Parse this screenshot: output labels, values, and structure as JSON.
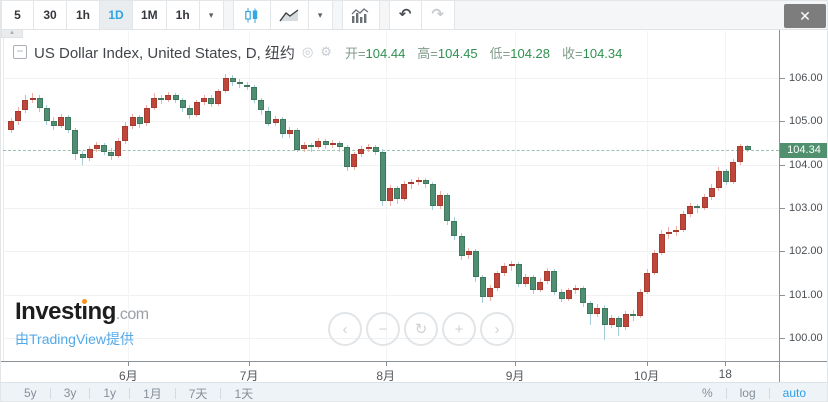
{
  "toolbar": {
    "intervals": [
      "5",
      "30",
      "1h",
      "1D",
      "1M",
      "1h"
    ],
    "selected_interval": "1D",
    "caret_icon": "▾",
    "undo_icon": "↶",
    "redo_icon": "↷",
    "close_icon": "✕",
    "collapse_tab_icon": "▴"
  },
  "header": {
    "collapse_icon": "−",
    "title": "US Dollar Index, United States, D, 纽约",
    "visibility_icon": "◎",
    "settings_icon": "⚙",
    "ohlc_readout": [
      {
        "label": "开",
        "value": "104.44"
      },
      {
        "label": "高",
        "value": "104.45"
      },
      {
        "label": "低",
        "value": "104.28"
      },
      {
        "label": "收",
        "value": "104.34"
      }
    ]
  },
  "chart_data": {
    "type": "candlestick",
    "symbol": "US Dollar Index",
    "region": "United States",
    "interval": "D",
    "exchange_label": "纽约",
    "ohlc": {
      "open": 104.44,
      "high": 104.45,
      "low": 104.28,
      "close": 104.34
    },
    "last_price": 104.34,
    "last_price_label": "104.34",
    "up_means": "close>open shown red (CN convention)",
    "y_axis": {
      "ticks": [
        {
          "label": "106.00",
          "value": 106
        },
        {
          "label": "105.00",
          "value": 105
        },
        {
          "label": "104.00",
          "value": 104
        },
        {
          "label": "103.00",
          "value": 103
        },
        {
          "label": "102.00",
          "value": 102
        },
        {
          "label": "101.00",
          "value": 101
        },
        {
          "label": "100.00",
          "value": 100
        }
      ],
      "range_top": 106.97,
      "range_bottom": 99.47,
      "grid": true
    },
    "x_axis": {
      "ticks": [
        {
          "label": "6月",
          "i": 16.4
        },
        {
          "label": "7月",
          "i": 33.3
        },
        {
          "label": "8月",
          "i": 52.4
        },
        {
          "label": "9月",
          "i": 70.5
        },
        {
          "label": "10月",
          "i": 88.9
        },
        {
          "label": "18",
          "i": 99.9
        }
      ]
    },
    "candles_format": [
      "open",
      "high",
      "low",
      "close"
    ],
    "candles": [
      [
        104.8,
        105.08,
        104.72,
        105.0
      ],
      [
        105.0,
        105.32,
        104.92,
        105.25
      ],
      [
        105.25,
        105.6,
        105.18,
        105.5
      ],
      [
        105.5,
        105.65,
        105.42,
        105.55
      ],
      [
        105.55,
        105.62,
        105.22,
        105.3
      ],
      [
        105.3,
        105.38,
        104.92,
        105.0
      ],
      [
        105.0,
        105.1,
        104.8,
        104.9
      ],
      [
        104.9,
        105.18,
        104.85,
        105.1
      ],
      [
        105.1,
        105.15,
        104.72,
        104.8
      ],
      [
        104.8,
        104.85,
        104.1,
        104.25
      ],
      [
        104.25,
        104.32,
        104.0,
        104.15
      ],
      [
        104.15,
        104.42,
        104.08,
        104.35
      ],
      [
        104.35,
        104.52,
        104.28,
        104.45
      ],
      [
        104.45,
        104.5,
        104.22,
        104.3
      ],
      [
        104.3,
        104.38,
        104.1,
        104.2
      ],
      [
        104.2,
        104.62,
        104.15,
        104.55
      ],
      [
        104.55,
        104.98,
        104.48,
        104.9
      ],
      [
        104.9,
        105.18,
        104.82,
        105.1
      ],
      [
        105.1,
        105.15,
        104.85,
        104.95
      ],
      [
        104.95,
        105.38,
        104.9,
        105.3
      ],
      [
        105.3,
        105.65,
        105.25,
        105.55
      ],
      [
        105.55,
        105.62,
        105.4,
        105.5
      ],
      [
        105.5,
        105.68,
        105.45,
        105.6
      ],
      [
        105.6,
        105.65,
        105.42,
        105.5
      ],
      [
        105.5,
        105.55,
        105.22,
        105.3
      ],
      [
        105.3,
        105.38,
        105.05,
        105.15
      ],
      [
        105.15,
        105.5,
        105.1,
        105.45
      ],
      [
        105.45,
        105.62,
        105.38,
        105.55
      ],
      [
        105.55,
        105.6,
        105.32,
        105.4
      ],
      [
        105.4,
        105.75,
        105.35,
        105.7
      ],
      [
        105.7,
        106.1,
        105.65,
        106.0
      ],
      [
        106.0,
        106.08,
        105.82,
        105.9
      ],
      [
        105.9,
        105.98,
        105.78,
        105.85
      ],
      [
        105.85,
        105.92,
        105.72,
        105.8
      ],
      [
        105.8,
        105.85,
        105.42,
        105.5
      ],
      [
        105.5,
        105.55,
        105.15,
        105.25
      ],
      [
        105.25,
        105.32,
        104.88,
        104.95
      ],
      [
        104.95,
        105.12,
        104.88,
        105.05
      ],
      [
        105.05,
        105.1,
        104.62,
        104.7
      ],
      [
        104.7,
        104.88,
        104.62,
        104.8
      ],
      [
        104.8,
        104.85,
        104.28,
        104.35
      ],
      [
        104.35,
        104.52,
        104.28,
        104.45
      ],
      [
        104.45,
        104.5,
        104.3,
        104.4
      ],
      [
        104.4,
        104.62,
        104.35,
        104.55
      ],
      [
        104.55,
        104.6,
        104.35,
        104.45
      ],
      [
        104.45,
        104.58,
        104.38,
        104.5
      ],
      [
        104.5,
        104.55,
        104.3,
        104.4
      ],
      [
        104.4,
        104.45,
        103.85,
        103.95
      ],
      [
        103.95,
        104.3,
        103.88,
        104.25
      ],
      [
        104.25,
        104.42,
        104.18,
        104.35
      ],
      [
        104.35,
        104.48,
        104.28,
        104.4
      ],
      [
        104.4,
        104.45,
        104.22,
        104.3
      ],
      [
        104.3,
        104.35,
        103.05,
        103.15
      ],
      [
        103.15,
        103.52,
        103.05,
        103.45
      ],
      [
        103.45,
        103.5,
        103.1,
        103.2
      ],
      [
        103.2,
        103.62,
        103.15,
        103.55
      ],
      [
        103.55,
        103.68,
        103.45,
        103.6
      ],
      [
        103.6,
        103.72,
        103.52,
        103.65
      ],
      [
        103.65,
        103.7,
        103.45,
        103.55
      ],
      [
        103.55,
        103.6,
        102.95,
        103.05
      ],
      [
        103.05,
        103.38,
        102.98,
        103.3
      ],
      [
        103.3,
        103.35,
        102.6,
        102.7
      ],
      [
        102.7,
        102.78,
        102.25,
        102.35
      ],
      [
        102.35,
        102.42,
        101.8,
        101.9
      ],
      [
        101.9,
        102.08,
        101.82,
        102.0
      ],
      [
        102.0,
        102.05,
        101.3,
        101.4
      ],
      [
        101.4,
        101.45,
        100.8,
        100.95
      ],
      [
        100.95,
        101.22,
        100.85,
        101.15
      ],
      [
        101.15,
        101.55,
        101.08,
        101.5
      ],
      [
        101.5,
        101.72,
        101.42,
        101.65
      ],
      [
        101.65,
        101.78,
        101.55,
        101.7
      ],
      [
        101.7,
        101.75,
        101.18,
        101.25
      ],
      [
        101.25,
        101.48,
        101.18,
        101.4
      ],
      [
        101.4,
        101.45,
        101.02,
        101.1
      ],
      [
        101.1,
        101.38,
        101.05,
        101.3
      ],
      [
        101.3,
        101.62,
        101.25,
        101.55
      ],
      [
        101.55,
        101.6,
        100.98,
        101.05
      ],
      [
        101.05,
        101.12,
        100.82,
        100.9
      ],
      [
        100.9,
        101.15,
        100.85,
        101.1
      ],
      [
        101.1,
        101.22,
        101.02,
        101.15
      ],
      [
        101.15,
        101.2,
        100.72,
        100.8
      ],
      [
        100.8,
        100.85,
        100.3,
        100.55
      ],
      [
        100.55,
        100.78,
        100.48,
        100.7
      ],
      [
        100.7,
        100.75,
        99.95,
        100.3
      ],
      [
        100.3,
        100.52,
        100.22,
        100.45
      ],
      [
        100.45,
        100.5,
        100.05,
        100.25
      ],
      [
        100.25,
        100.62,
        100.18,
        100.55
      ],
      [
        100.55,
        100.65,
        100.38,
        100.5
      ],
      [
        100.5,
        101.12,
        100.45,
        101.05
      ],
      [
        101.05,
        101.58,
        101.0,
        101.5
      ],
      [
        101.5,
        102.02,
        101.45,
        101.95
      ],
      [
        101.95,
        102.48,
        101.9,
        102.4
      ],
      [
        102.4,
        102.55,
        102.28,
        102.45
      ],
      [
        102.45,
        102.58,
        102.35,
        102.5
      ],
      [
        102.5,
        102.92,
        102.45,
        102.85
      ],
      [
        102.85,
        103.12,
        102.78,
        103.05
      ],
      [
        103.05,
        103.1,
        102.88,
        103.0
      ],
      [
        103.0,
        103.32,
        102.95,
        103.25
      ],
      [
        103.25,
        103.55,
        103.18,
        103.45
      ],
      [
        103.45,
        103.95,
        103.4,
        103.85
      ],
      [
        103.85,
        103.9,
        103.52,
        103.6
      ],
      [
        103.6,
        104.12,
        103.55,
        104.05
      ],
      [
        104.05,
        104.48,
        104.0,
        104.44
      ],
      [
        104.44,
        104.45,
        104.28,
        104.34
      ]
    ],
    "colors": {
      "up_fill": "#c0453a",
      "up_border": "#a63b30",
      "up_wick": "#ecb0a8",
      "down_fill": "#4e8f73",
      "down_border": "#40785e",
      "down_wick": "#a5cdd9",
      "badge_bg": "#50906f",
      "badge_text": "#ffffff",
      "accent_blue": "#30a3e1",
      "ohlc_green": "#2f9150",
      "grid": "#eff1f3"
    }
  },
  "nav": {
    "buttons": [
      {
        "name": "scroll-left",
        "glyph": "‹"
      },
      {
        "name": "zoom-out",
        "glyph": "−"
      },
      {
        "name": "reset-view",
        "glyph": "↻"
      },
      {
        "name": "zoom-in",
        "glyph": "+"
      },
      {
        "name": "scroll-right",
        "glyph": "›"
      }
    ]
  },
  "logo": {
    "brand_left": "Invest",
    "brand_dotless_i": "ı",
    "brand_right": "ng",
    "tld": ".com",
    "attribution": "由TradingView提供"
  },
  "range_bar": {
    "ranges": [
      "5y",
      "3y",
      "1y",
      "1月",
      "7天",
      "1天"
    ],
    "scales": [
      "%",
      "log",
      "auto"
    ],
    "active_scale": "auto"
  }
}
